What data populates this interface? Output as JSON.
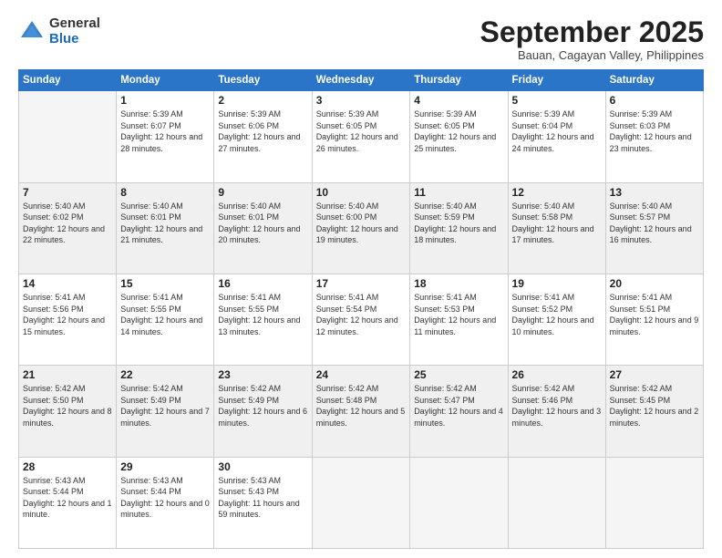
{
  "logo": {
    "general": "General",
    "blue": "Blue"
  },
  "title": "September 2025",
  "location": "Bauan, Cagayan Valley, Philippines",
  "weekdays": [
    "Sunday",
    "Monday",
    "Tuesday",
    "Wednesday",
    "Thursday",
    "Friday",
    "Saturday"
  ],
  "weeks": [
    [
      {
        "num": "",
        "info": ""
      },
      {
        "num": "1",
        "info": "Sunrise: 5:39 AM\nSunset: 6:07 PM\nDaylight: 12 hours\nand 28 minutes."
      },
      {
        "num": "2",
        "info": "Sunrise: 5:39 AM\nSunset: 6:06 PM\nDaylight: 12 hours\nand 27 minutes."
      },
      {
        "num": "3",
        "info": "Sunrise: 5:39 AM\nSunset: 6:05 PM\nDaylight: 12 hours\nand 26 minutes."
      },
      {
        "num": "4",
        "info": "Sunrise: 5:39 AM\nSunset: 6:05 PM\nDaylight: 12 hours\nand 25 minutes."
      },
      {
        "num": "5",
        "info": "Sunrise: 5:39 AM\nSunset: 6:04 PM\nDaylight: 12 hours\nand 24 minutes."
      },
      {
        "num": "6",
        "info": "Sunrise: 5:39 AM\nSunset: 6:03 PM\nDaylight: 12 hours\nand 23 minutes."
      }
    ],
    [
      {
        "num": "7",
        "info": "Sunrise: 5:40 AM\nSunset: 6:02 PM\nDaylight: 12 hours\nand 22 minutes."
      },
      {
        "num": "8",
        "info": "Sunrise: 5:40 AM\nSunset: 6:01 PM\nDaylight: 12 hours\nand 21 minutes."
      },
      {
        "num": "9",
        "info": "Sunrise: 5:40 AM\nSunset: 6:01 PM\nDaylight: 12 hours\nand 20 minutes."
      },
      {
        "num": "10",
        "info": "Sunrise: 5:40 AM\nSunset: 6:00 PM\nDaylight: 12 hours\nand 19 minutes."
      },
      {
        "num": "11",
        "info": "Sunrise: 5:40 AM\nSunset: 5:59 PM\nDaylight: 12 hours\nand 18 minutes."
      },
      {
        "num": "12",
        "info": "Sunrise: 5:40 AM\nSunset: 5:58 PM\nDaylight: 12 hours\nand 17 minutes."
      },
      {
        "num": "13",
        "info": "Sunrise: 5:40 AM\nSunset: 5:57 PM\nDaylight: 12 hours\nand 16 minutes."
      }
    ],
    [
      {
        "num": "14",
        "info": "Sunrise: 5:41 AM\nSunset: 5:56 PM\nDaylight: 12 hours\nand 15 minutes."
      },
      {
        "num": "15",
        "info": "Sunrise: 5:41 AM\nSunset: 5:55 PM\nDaylight: 12 hours\nand 14 minutes."
      },
      {
        "num": "16",
        "info": "Sunrise: 5:41 AM\nSunset: 5:55 PM\nDaylight: 12 hours\nand 13 minutes."
      },
      {
        "num": "17",
        "info": "Sunrise: 5:41 AM\nSunset: 5:54 PM\nDaylight: 12 hours\nand 12 minutes."
      },
      {
        "num": "18",
        "info": "Sunrise: 5:41 AM\nSunset: 5:53 PM\nDaylight: 12 hours\nand 11 minutes."
      },
      {
        "num": "19",
        "info": "Sunrise: 5:41 AM\nSunset: 5:52 PM\nDaylight: 12 hours\nand 10 minutes."
      },
      {
        "num": "20",
        "info": "Sunrise: 5:41 AM\nSunset: 5:51 PM\nDaylight: 12 hours\nand 9 minutes."
      }
    ],
    [
      {
        "num": "21",
        "info": "Sunrise: 5:42 AM\nSunset: 5:50 PM\nDaylight: 12 hours\nand 8 minutes."
      },
      {
        "num": "22",
        "info": "Sunrise: 5:42 AM\nSunset: 5:49 PM\nDaylight: 12 hours\nand 7 minutes."
      },
      {
        "num": "23",
        "info": "Sunrise: 5:42 AM\nSunset: 5:49 PM\nDaylight: 12 hours\nand 6 minutes."
      },
      {
        "num": "24",
        "info": "Sunrise: 5:42 AM\nSunset: 5:48 PM\nDaylight: 12 hours\nand 5 minutes."
      },
      {
        "num": "25",
        "info": "Sunrise: 5:42 AM\nSunset: 5:47 PM\nDaylight: 12 hours\nand 4 minutes."
      },
      {
        "num": "26",
        "info": "Sunrise: 5:42 AM\nSunset: 5:46 PM\nDaylight: 12 hours\nand 3 minutes."
      },
      {
        "num": "27",
        "info": "Sunrise: 5:42 AM\nSunset: 5:45 PM\nDaylight: 12 hours\nand 2 minutes."
      }
    ],
    [
      {
        "num": "28",
        "info": "Sunrise: 5:43 AM\nSunset: 5:44 PM\nDaylight: 12 hours\nand 1 minute."
      },
      {
        "num": "29",
        "info": "Sunrise: 5:43 AM\nSunset: 5:44 PM\nDaylight: 12 hours\nand 0 minutes."
      },
      {
        "num": "30",
        "info": "Sunrise: 5:43 AM\nSunset: 5:43 PM\nDaylight: 11 hours\nand 59 minutes."
      },
      {
        "num": "",
        "info": ""
      },
      {
        "num": "",
        "info": ""
      },
      {
        "num": "",
        "info": ""
      },
      {
        "num": "",
        "info": ""
      }
    ]
  ]
}
